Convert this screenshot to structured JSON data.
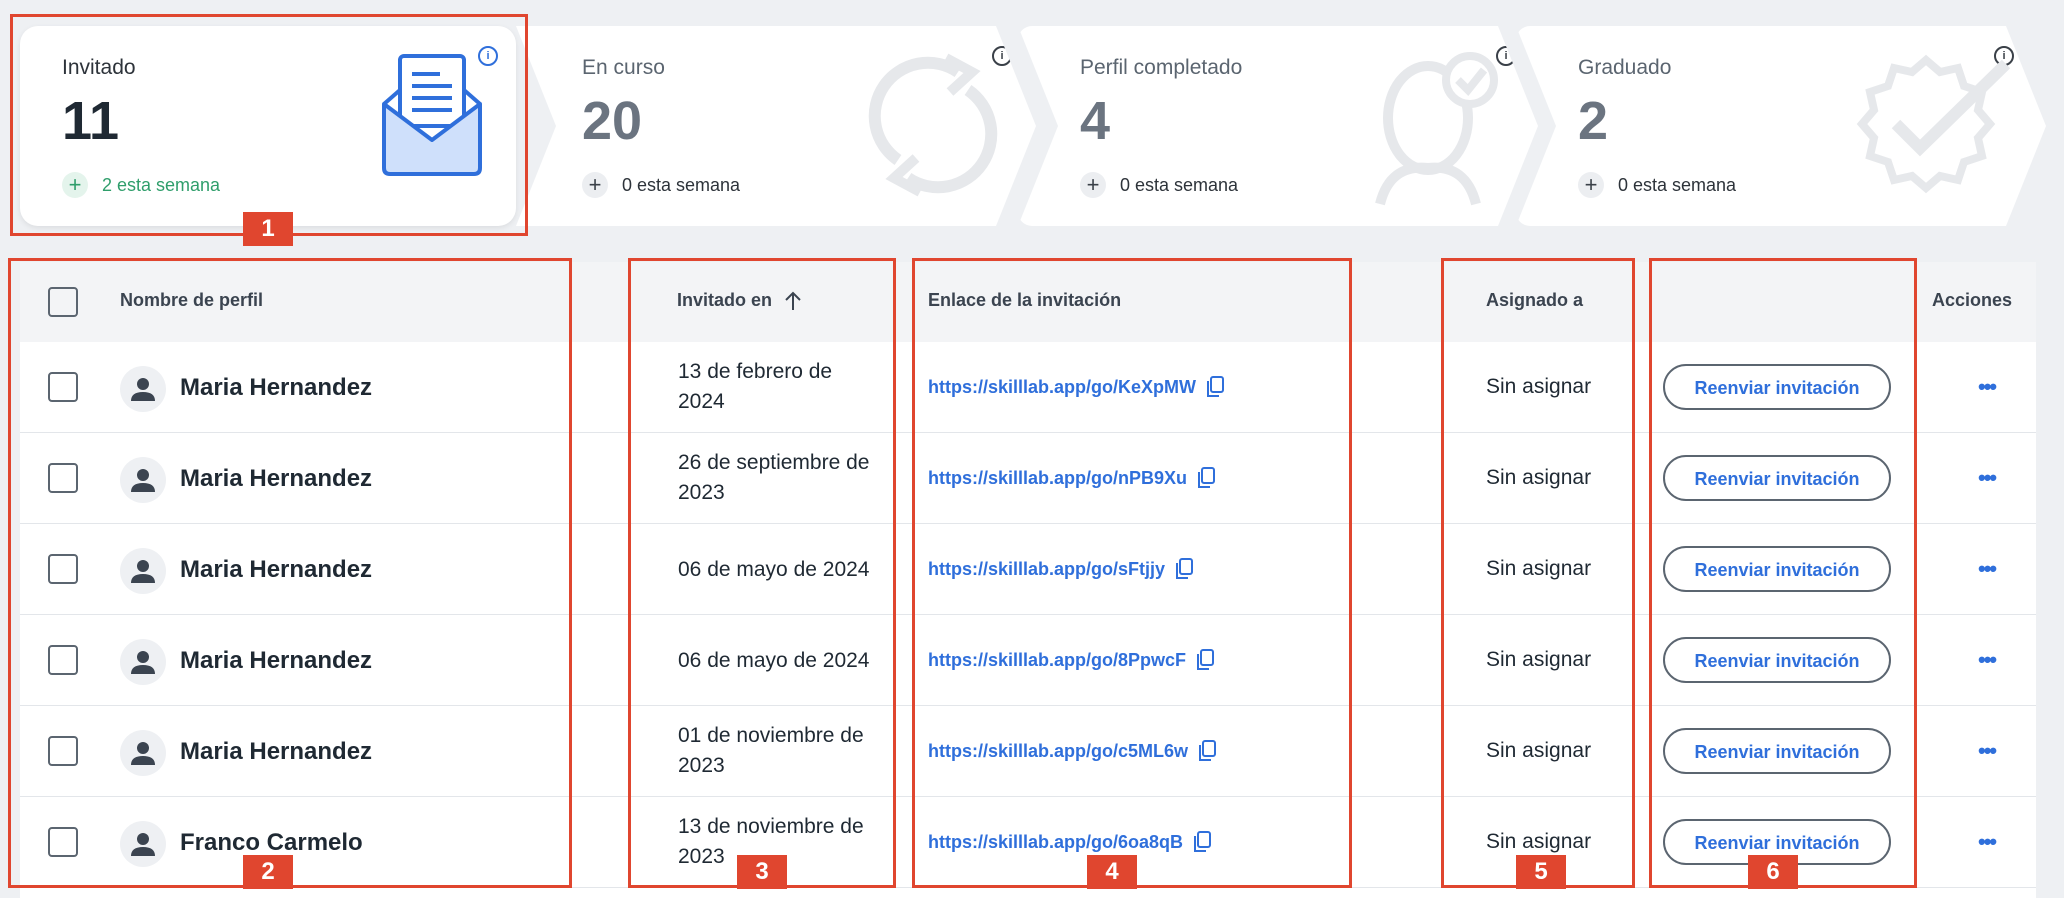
{
  "stages": [
    {
      "label": "Invitado",
      "count": "11",
      "week": "2 esta semana",
      "icon": "envelope-letter-icon"
    },
    {
      "label": "En curso",
      "count": "20",
      "week": "0 esta semana",
      "icon": "refresh-cycle-icon"
    },
    {
      "label": "Perfil completado",
      "count": "4",
      "week": "0 esta semana",
      "icon": "profile-check-icon"
    },
    {
      "label": "Graduado",
      "count": "2",
      "week": "0 esta semana",
      "icon": "badge-check-icon"
    }
  ],
  "table": {
    "headers": {
      "name": "Nombre de perfil",
      "invited": "Invitado en",
      "link": "Enlace de la invitación",
      "assigned": "Asignado a",
      "actions": "Acciones"
    },
    "rows": [
      {
        "name": "Maria Hernandez",
        "date_line1": "13 de febrero de",
        "date_line2": "2024",
        "link": "https://skilllab.app/go/KeXpMW",
        "assigned": "Sin asignar",
        "action": "Reenviar invitación"
      },
      {
        "name": "Maria Hernandez",
        "date_line1": "26 de septiembre de",
        "date_line2": "2023",
        "link": "https://skilllab.app/go/nPB9Xu",
        "assigned": "Sin asignar",
        "action": "Reenviar invitación"
      },
      {
        "name": "Maria Hernandez",
        "date_line1": "06 de mayo de 2024",
        "date_line2": "",
        "link": "https://skilllab.app/go/sFtjjy",
        "assigned": "Sin asignar",
        "action": "Reenviar invitación"
      },
      {
        "name": "Maria Hernandez",
        "date_line1": "06 de mayo de 2024",
        "date_line2": "",
        "link": "https://skilllab.app/go/8PpwcF",
        "assigned": "Sin asignar",
        "action": "Reenviar invitación"
      },
      {
        "name": "Maria Hernandez",
        "date_line1": "01 de noviembre de",
        "date_line2": "2023",
        "link": "https://skilllab.app/go/c5ML6w",
        "assigned": "Sin asignar",
        "action": "Reenviar invitación"
      },
      {
        "name": "Franco Carmelo",
        "date_line1": "13 de noviembre de",
        "date_line2": "2023",
        "link": "https://skilllab.app/go/6oa8qB",
        "assigned": "Sin asignar",
        "action": "Reenviar invitación"
      }
    ]
  },
  "annotations": [
    "1",
    "2",
    "3",
    "4",
    "5",
    "6"
  ],
  "colors": {
    "accent": "#2f6fdb",
    "success": "#2f9e6b",
    "annotation": "#e0462f"
  }
}
